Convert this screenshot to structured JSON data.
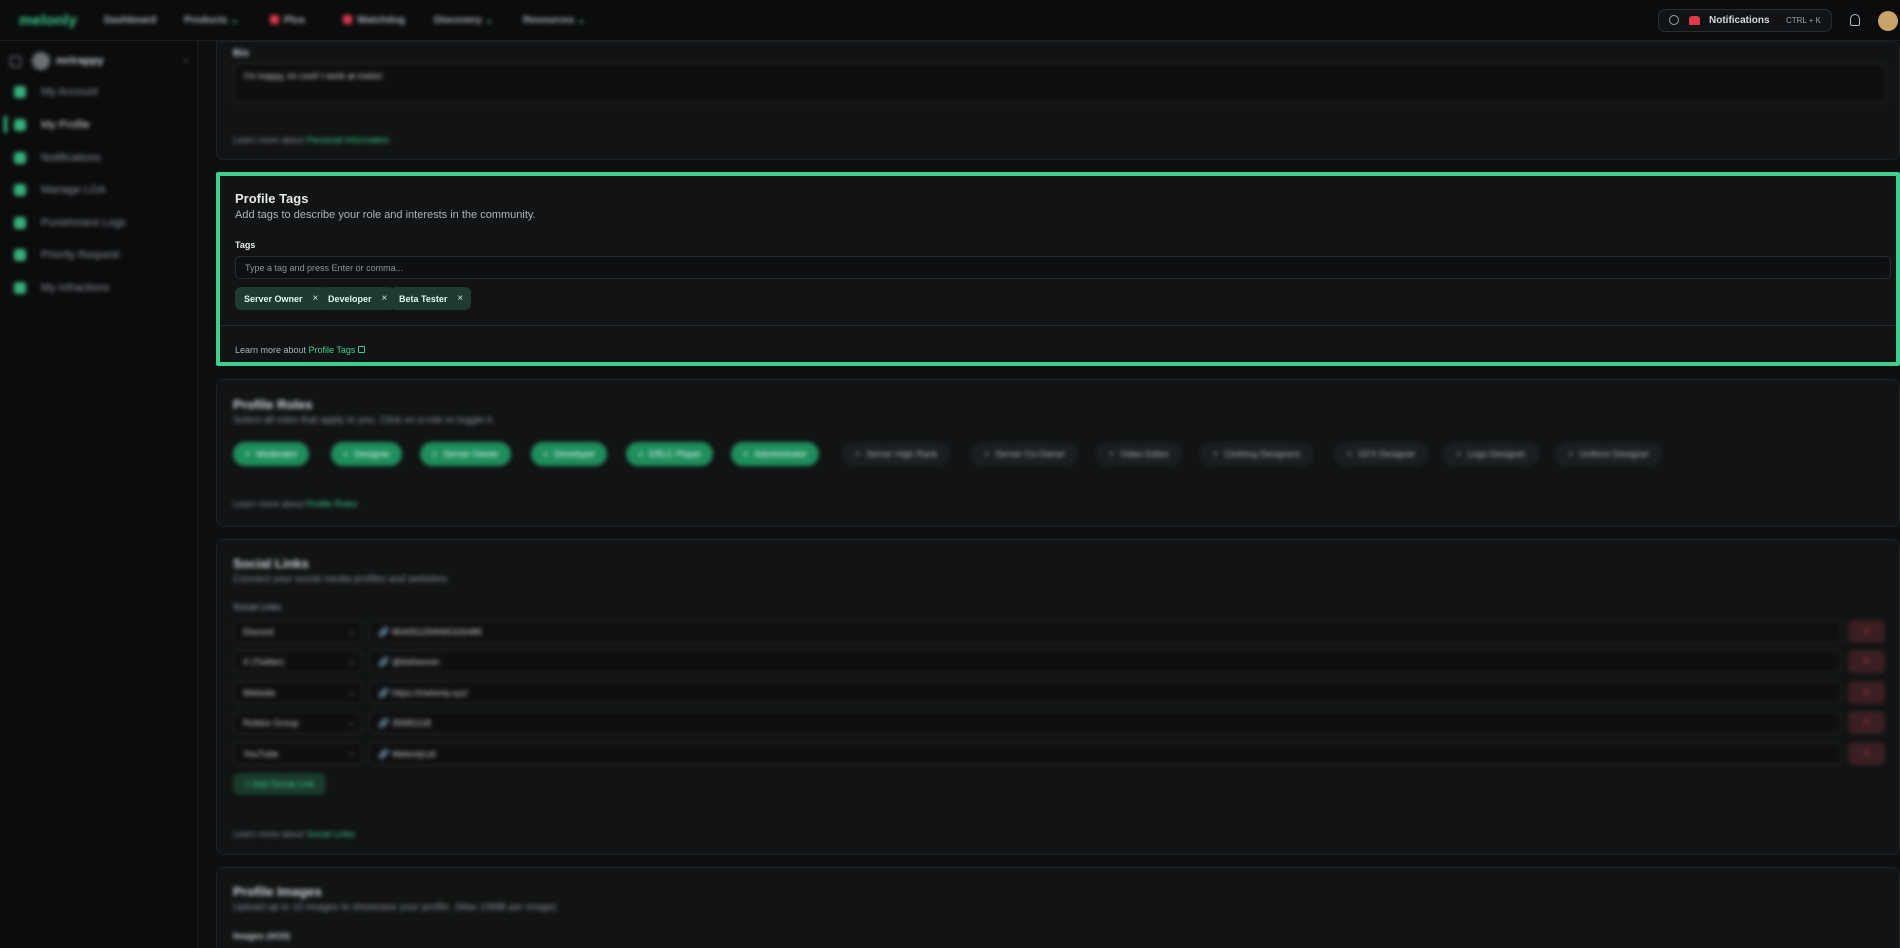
{
  "nav": {
    "logo": "melonly",
    "items": [
      {
        "label": "Dashboard",
        "chevron": ""
      },
      {
        "label": "Products",
        "chevron": "⌄"
      },
      {
        "label": "Plus",
        "chevron": ""
      },
      {
        "label": "Watchdog",
        "chevron": ""
      },
      {
        "label": "Discovery",
        "chevron": "⌄"
      },
      {
        "label": "Resources",
        "chevron": "⌄"
      }
    ],
    "search_label": "Notifications",
    "search_shortcut": "CTRL + K"
  },
  "sidebar": {
    "username": "mrtrappy",
    "items": [
      {
        "label": "My Account"
      },
      {
        "label": "My Profile"
      },
      {
        "label": "Notifications"
      },
      {
        "label": "Manage LOA"
      },
      {
        "label": "Punishment Logs"
      },
      {
        "label": "Priority Request"
      },
      {
        "label": "My Infractions"
      }
    ]
  },
  "bio": {
    "label": "Bio",
    "value": "I'm trappy, im cool! I work at melon",
    "foot_prefix": "Learn more about ",
    "foot_link": "Personal Information"
  },
  "profile_tags": {
    "title": "Profile Tags",
    "subtitle": "Add tags to describe your role and interests in the community.",
    "field_label": "Tags",
    "placeholder": "Type a tag and press Enter or comma...",
    "tags": [
      "Server Owner",
      "Developer",
      "Beta Tester"
    ],
    "remove_glyph": "×",
    "foot_prefix": "Learn more about ",
    "foot_link": "Profile Tags"
  },
  "profile_roles": {
    "title": "Profile Roles",
    "subtitle": "Select all roles that apply to you. Click on a role to toggle it.",
    "roles": [
      {
        "label": "Moderator",
        "selected": true,
        "glyph": "×"
      },
      {
        "label": "Designer",
        "selected": true,
        "glyph": "×"
      },
      {
        "label": "Server Owner",
        "selected": true,
        "glyph": "×"
      },
      {
        "label": "Developer",
        "selected": true,
        "glyph": "×"
      },
      {
        "label": "ERLC Player",
        "selected": true,
        "glyph": "×"
      },
      {
        "label": "Administrator",
        "selected": true,
        "glyph": "×"
      },
      {
        "label": "Server High Rank",
        "selected": false,
        "glyph": "+"
      },
      {
        "label": "Server Co-Owner",
        "selected": false,
        "glyph": "+"
      },
      {
        "label": "Video Editor",
        "selected": false,
        "glyph": "+"
      },
      {
        "label": "Clothing Designers",
        "selected": false,
        "glyph": "+"
      },
      {
        "label": "GFX Designer",
        "selected": false,
        "glyph": "+"
      },
      {
        "label": "Logo Designer",
        "selected": false,
        "glyph": "+"
      },
      {
        "label": "Uniform Designer",
        "selected": false,
        "glyph": "+"
      }
    ],
    "foot_prefix": "Learn more about ",
    "foot_link": "Profile Roles"
  },
  "social_links": {
    "title": "Social Links",
    "subtitle": "Connect your social media profiles and websites.",
    "field_label": "Social Links",
    "rows": [
      {
        "platform": "Discord",
        "value": "854051259065326485"
      },
      {
        "platform": "X (Twitter)",
        "value": "@itstheonin"
      },
      {
        "platform": "Website",
        "value": "https://melonly.xyz/"
      },
      {
        "platform": "Roblox Group",
        "value": "35681118"
      },
      {
        "platform": "YouTube",
        "value": "MelonlyLtd"
      }
    ],
    "select_chevron": "›",
    "link_glyph": "🔗",
    "delete_glyph": "×",
    "add_label": "+ Add Social Link",
    "foot_prefix": "Learn more about ",
    "foot_link": "Social Links"
  },
  "profile_images": {
    "title": "Profile Images",
    "subtitle": "Upload up to 10 images to showcase your profile. (Max 10MB per image)",
    "field_label": "Images (4/10)"
  },
  "colors": {
    "accent": "#3ecf8e",
    "background": "#0e0f10",
    "card": "#111314",
    "danger": "#e0394a"
  }
}
